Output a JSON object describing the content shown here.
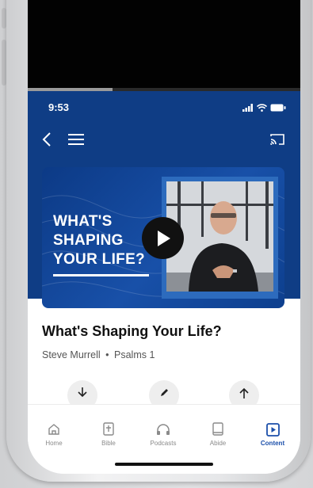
{
  "status_bar": {
    "time": "9:53"
  },
  "hero": {
    "title_lines": [
      "WHAT'S",
      "SHAPING",
      "YOUR LIFE?"
    ]
  },
  "video": {
    "progress_fraction": 0.31
  },
  "sermon": {
    "title": "What's Shaping Your Life?",
    "speaker": "Steve Murrell",
    "separator": "•",
    "passage": "Psalms 1"
  },
  "actions": [
    {
      "icon": "download-icon"
    },
    {
      "icon": "notes-icon"
    },
    {
      "icon": "share-icon"
    }
  ],
  "tabs": [
    {
      "label": "Home",
      "icon": "home-icon",
      "active": false
    },
    {
      "label": "Bible",
      "icon": "bible-icon",
      "active": false
    },
    {
      "label": "Podcasts",
      "icon": "headphones-icon",
      "active": false
    },
    {
      "label": "Abide",
      "icon": "book-icon",
      "active": false
    },
    {
      "label": "Content",
      "icon": "play-square-icon",
      "active": true
    }
  ],
  "colors": {
    "header_blue": "#0f3d85",
    "accent_blue": "#1b4faa",
    "inactive_gray": "#8a8a8a"
  }
}
